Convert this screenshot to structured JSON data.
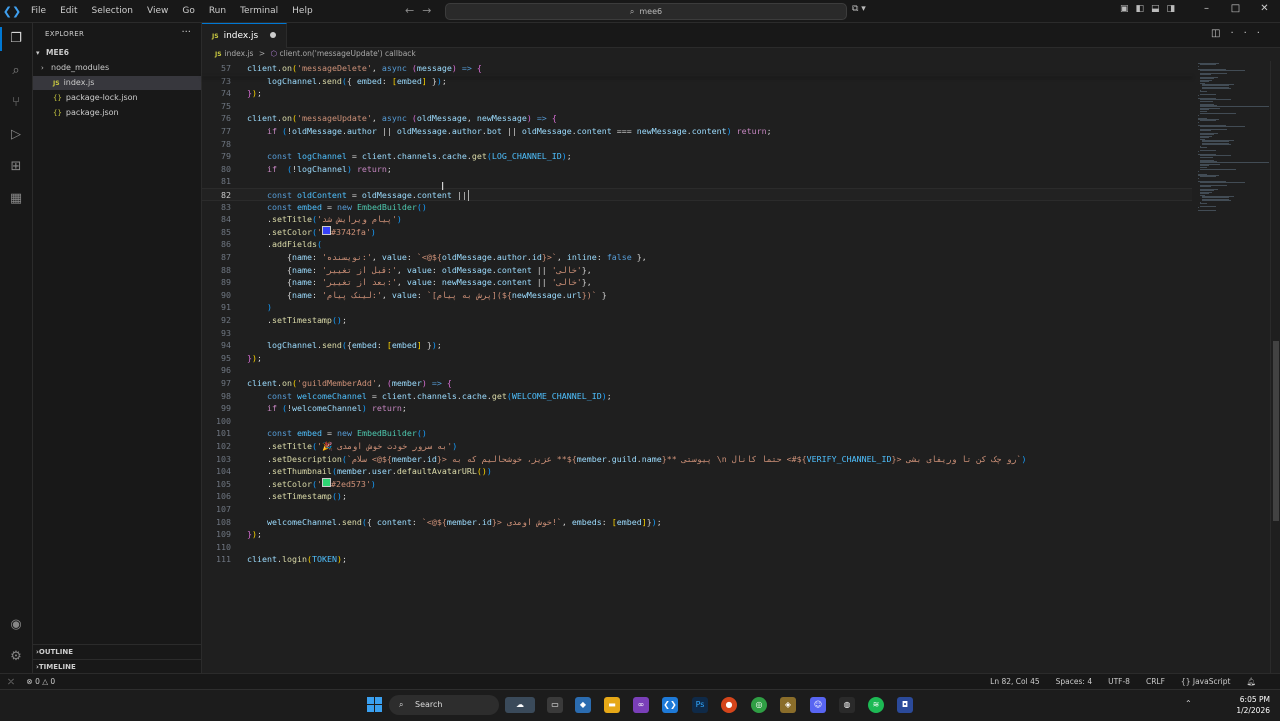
{
  "window": {
    "menu": [
      "File",
      "Edit",
      "Selection",
      "View",
      "Go",
      "Run",
      "Terminal",
      "Help"
    ],
    "search": "mee6"
  },
  "sidebar": {
    "header": "EXPLORER",
    "project": "MEE6",
    "items": [
      {
        "label": "node_modules",
        "type": "folder"
      },
      {
        "label": "index.js",
        "type": "js",
        "selected": true
      },
      {
        "label": "package-lock.json",
        "type": "json"
      },
      {
        "label": "package.json",
        "type": "json"
      }
    ],
    "outline": "OUTLINE",
    "timeline": "TIMELINE"
  },
  "tab": {
    "label": "index.js",
    "modified": true
  },
  "breadcrumb": {
    "file": "index.js",
    "sep": ">",
    "symbol": "client.on('messageUpdate') callback"
  },
  "editor": {
    "lines": [
      {
        "n": "57",
        "html": "<span class=\"v\">client</span>.<span class=\"f\">on</span><span class=\"b1\">(</span><span class=\"s\">'messageDelete'</span>, <span class=\"k\">async</span> <span class=\"b2\">(</span><span class=\"v\">message</span><span class=\"b2\">)</span> <span class=\"k\">=&gt;</span> <span class=\"b2\">{</span>"
      },
      {
        "n": "73",
        "html": "    <span class=\"v\">logChannel</span>.<span class=\"f\">send</span><span class=\"b3\">(</span>{ <span class=\"v\">embed</span>: <span class=\"b1\">[</span><span class=\"v\">embed</span><span class=\"b1\">]</span> }<span class=\"b3\">)</span>;"
      },
      {
        "n": "74",
        "html": "<span class=\"b2\">}</span><span class=\"b1\">)</span>;"
      },
      {
        "n": "75",
        "html": ""
      },
      {
        "n": "76",
        "html": "<span class=\"v\">client</span>.<span class=\"f\">on</span><span class=\"b1\">(</span><span class=\"s\">'messageUpdate'</span>, <span class=\"k\">async</span> <span class=\"b2\">(</span><span class=\"v\">oldMessage</span>, <span class=\"v\">newMessage</span><span class=\"b2\">)</span> <span class=\"k\">=&gt;</span> <span class=\"b2\">{</span>"
      },
      {
        "n": "77",
        "html": "    <span class=\"kc\">if</span> <span class=\"b3\">(</span>!<span class=\"v\">oldMessage</span>.<span class=\"v\">author</span> || <span class=\"v\">oldMessage</span>.<span class=\"v\">author</span>.<span class=\"v\">bot</span> || <span class=\"v\">oldMessage</span>.<span class=\"v\">content</span> === <span class=\"v\">newMessage</span>.<span class=\"v\">content</span><span class=\"b3\">)</span> <span class=\"kc\">return</span>;"
      },
      {
        "n": "78",
        "html": ""
      },
      {
        "n": "79",
        "html": "    <span class=\"k\">const</span> <span class=\"c\">logChannel</span> = <span class=\"v\">client</span>.<span class=\"v\">channels</span>.<span class=\"v\">cache</span>.<span class=\"f\">get</span><span class=\"b3\">(</span><span class=\"c\">LOG_CHANNEL_ID</span><span class=\"b3\">)</span>;"
      },
      {
        "n": "80",
        "html": "    <span class=\"kc\">if</span>  <span class=\"b3\">(</span>!<span class=\"v\">logChannel</span><span class=\"b3\">)</span> <span class=\"kc\">return</span>;"
      },
      {
        "n": "81",
        "html": ""
      },
      {
        "n": "82",
        "html": "    <span class=\"k\">const</span> <span class=\"c\">oldContent</span> = <span class=\"v\">oldMessage</span>.<span class=\"v\">content</span> ||",
        "current": true
      },
      {
        "n": "83",
        "html": "    <span class=\"k\">const</span> <span class=\"c\">embed</span> = <span class=\"k\">new</span> <span class=\"t\">EmbedBuilder</span><span class=\"b3\">()</span>"
      },
      {
        "n": "84",
        "html": "    .<span class=\"f\">setTitle</span><span class=\"b3\">(</span><span class=\"s\">'پیام ویرایش شد'</span><span class=\"b3\">)</span>"
      },
      {
        "n": "85",
        "html": "    .<span class=\"f\">setColor</span><span class=\"b3\">(</span><span class=\"s\">'<span style=\"display:inline-block;width:7px;height:7px;background:#3742fa;border:1px solid #ccc;\"></span>#3742fa'</span><span class=\"b3\">)</span>"
      },
      {
        "n": "86",
        "html": "    .<span class=\"f\">addFields</span><span class=\"b3\">(</span>"
      },
      {
        "n": "87",
        "html": "        {<span class=\"v\">name</span>: <span class=\"s\">'نویسنده:'</span>, <span class=\"v\">value</span>: <span class=\"s\">`&lt;@${</span><span class=\"v\">oldMessage</span>.<span class=\"v\">author</span>.<span class=\"v\">id</span><span class=\"s\">}&gt;`</span>, <span class=\"v\">inline</span>: <span class=\"k\">false</span> },"
      },
      {
        "n": "88",
        "html": "        {<span class=\"v\">name</span>: <span class=\"s\">'قبل از تغییر:'</span>, <span class=\"v\">value</span>: <span class=\"v\">oldMessage</span>.<span class=\"v\">content</span> || <span class=\"s\">'خالی'</span>},"
      },
      {
        "n": "89",
        "html": "        {<span class=\"v\">name</span>: <span class=\"s\">'بعد از تغییر:'</span>, <span class=\"v\">value</span>: <span class=\"v\">newMessage</span>.<span class=\"v\">content</span> || <span class=\"s\">'خالی'</span>},"
      },
      {
        "n": "90",
        "html": "        {<span class=\"v\">name</span>: <span class=\"s\">'لینک پیام:'</span>, <span class=\"v\">value</span>: <span class=\"s\">`[پرش به پیام](${</span><span class=\"v\">newMessage</span>.<span class=\"v\">url</span><span class=\"s\">})`</span> }"
      },
      {
        "n": "91",
        "html": "    <span class=\"b3\">)</span>"
      },
      {
        "n": "92",
        "html": "    .<span class=\"f\">setTimestamp</span><span class=\"b3\">()</span>;"
      },
      {
        "n": "93",
        "html": ""
      },
      {
        "n": "94",
        "html": "    <span class=\"v\">logChannel</span>.<span class=\"f\">send</span><span class=\"b3\">(</span>{<span class=\"v\">embed</span>: <span class=\"b1\">[</span><span class=\"v\">embed</span><span class=\"b1\">]</span> }<span class=\"b3\">)</span>;"
      },
      {
        "n": "95",
        "html": "<span class=\"b2\">}</span><span class=\"b1\">)</span>;"
      },
      {
        "n": "96",
        "html": ""
      },
      {
        "n": "97",
        "html": "<span class=\"v\">client</span>.<span class=\"f\">on</span><span class=\"b1\">(</span><span class=\"s\">'guildMemberAdd'</span>, <span class=\"b2\">(</span><span class=\"v\">member</span><span class=\"b2\">)</span> <span class=\"k\">=&gt;</span> <span class=\"b2\">{</span>"
      },
      {
        "n": "98",
        "html": "    <span class=\"k\">const</span> <span class=\"c\">welcomeChannel</span> = <span class=\"v\">client</span>.<span class=\"v\">channels</span>.<span class=\"v\">cache</span>.<span class=\"f\">get</span><span class=\"b3\">(</span><span class=\"c\">WELCOME_CHANNEL_ID</span><span class=\"b3\">)</span>;"
      },
      {
        "n": "99",
        "html": "    <span class=\"kc\">if</span> <span class=\"b3\">(</span>!<span class=\"v\">welcomeChannel</span><span class=\"b3\">)</span> <span class=\"kc\">return</span>;"
      },
      {
        "n": "100",
        "html": ""
      },
      {
        "n": "101",
        "html": "    <span class=\"k\">const</span> <span class=\"c\">embed</span> = <span class=\"k\">new</span> <span class=\"t\">EmbedBuilder</span><span class=\"b3\">()</span>"
      },
      {
        "n": "102",
        "html": "    .<span class=\"f\">setTitle</span><span class=\"b3\">(</span><span class=\"s\">'🎉 به سرور خودت خوش اومدی'</span><span class=\"b3\">)</span>"
      },
      {
        "n": "103",
        "html": "    .<span class=\"f\">setDescription</span><span class=\"b3\">(</span><span class=\"s\">`سلام &lt;@${</span><span class=\"v\">member</span>.<span class=\"v\">id</span><span class=\"s\">}&gt; عزیز، خوشحالیم که به **${</span><span class=\"v\">member</span>.<span class=\"v\">guild</span>.<span class=\"v\">name</span><span class=\"s\">}** پیوستی \\n حتما کانال &lt;#${</span><span class=\"c\">VERIFY_CHANNEL_ID</span><span class=\"s\">}&gt; رو چک کن تا وریفای بشی`</span><span class=\"b3\">)</span>"
      },
      {
        "n": "104",
        "html": "    .<span class=\"f\">setThumbnail</span><span class=\"b3\">(</span><span class=\"v\">member</span>.<span class=\"v\">user</span>.<span class=\"f\">defaultAvatarURL</span><span class=\"b1\">()</span><span class=\"b3\">)</span>"
      },
      {
        "n": "105",
        "html": "    .<span class=\"f\">setColor</span><span class=\"b3\">(</span><span class=\"s\">'<span style=\"display:inline-block;width:7px;height:7px;background:#2ed573;border:1px solid #ccc;\"></span>#2ed573'</span><span class=\"b3\">)</span>"
      },
      {
        "n": "106",
        "html": "    .<span class=\"f\">setTimestamp</span><span class=\"b3\">()</span>;"
      },
      {
        "n": "107",
        "html": ""
      },
      {
        "n": "108",
        "html": "    <span class=\"v\">welcomeChannel</span>.<span class=\"f\">send</span><span class=\"b3\">(</span>{ <span class=\"v\">content</span>: <span class=\"s\">`&lt;@${</span><span class=\"v\">member</span>.<span class=\"v\">id</span><span class=\"s\">}&gt; خوش اومدی!`</span>, <span class=\"v\">embeds</span>: <span class=\"b1\">[</span><span class=\"v\">embed</span><span class=\"b1\">]</span>}<span class=\"b3\">)</span>;"
      },
      {
        "n": "109",
        "html": "<span class=\"b2\">}</span><span class=\"b1\">)</span>;"
      },
      {
        "n": "110",
        "html": ""
      },
      {
        "n": "111",
        "html": "<span class=\"v\">client</span>.<span class=\"f\">login</span><span class=\"b1\">(</span><span class=\"c\">TOKEN</span><span class=\"b1\">)</span>;"
      }
    ]
  },
  "status": {
    "errors": "0",
    "warnings": "0",
    "position": "Ln 82, Col 45",
    "spaces": "Spaces: 4",
    "encoding": "UTF-8",
    "eol": "CRLF",
    "language": "JavaScript"
  },
  "taskbar": {
    "search": "Search",
    "time": "6:05 PM",
    "date": "1/2/2026"
  }
}
